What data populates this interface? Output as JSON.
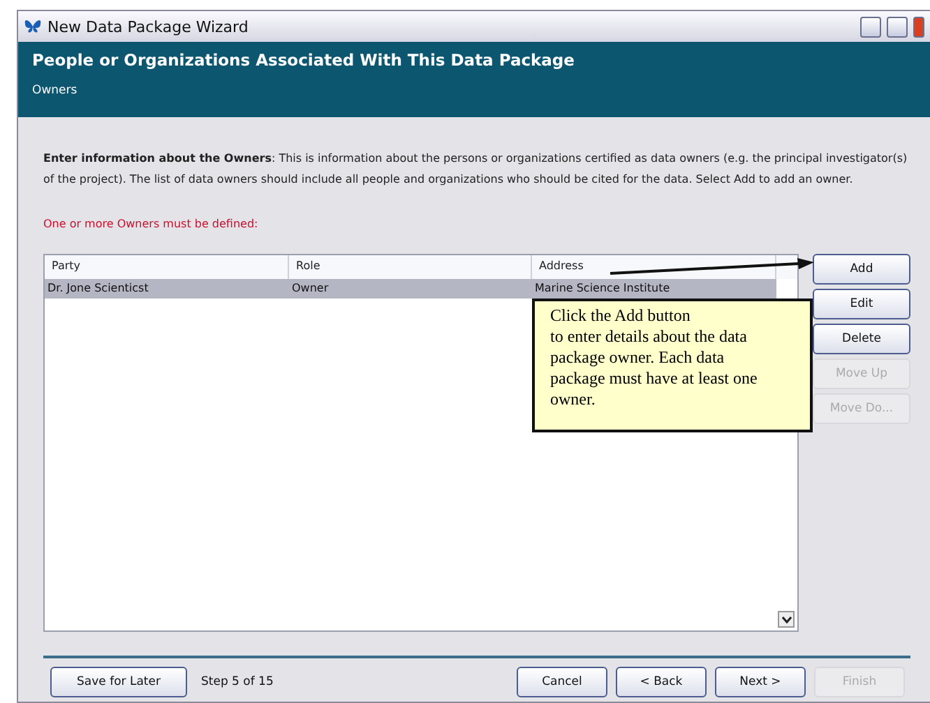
{
  "window": {
    "title": "New Data Package Wizard"
  },
  "header": {
    "title": "People or Organizations Associated With This Data Package",
    "subtitle": "Owners"
  },
  "intro": "**Enter information about the Owners**: This is information about the persons or organizations certified as data owners (e.g. the principal investigator(s) of the project). The list of data owners should include all people and organizations who should be cited for the data. Select Add to add an owner.",
  "error": "One or more Owners must be defined:",
  "table": {
    "columns": [
      "Party",
      "Role",
      "Address"
    ],
    "rows": [
      {
        "cells": [
          "Dr. Jone Scienticst",
          "Owner",
          "Marine Science Institute"
        ],
        "selected": true
      }
    ]
  },
  "side_buttons": [
    {
      "label": "Add",
      "disabled": false
    },
    {
      "label": "Edit",
      "disabled": false
    },
    {
      "label": "Delete",
      "disabled": false
    },
    {
      "label": "Move Up",
      "disabled": true
    },
    {
      "label": "Move Do...",
      "disabled": true
    }
  ],
  "callout": "Click the Add button\nto enter details about the data package owner. Each data package must have at least one owner.",
  "footer": {
    "save": "Save for Later",
    "step": "Step 5 of 15",
    "buttons": [
      {
        "label": "Cancel",
        "disabled": false
      },
      {
        "label": "< Back",
        "disabled": false
      },
      {
        "label": "Next >",
        "disabled": false
      },
      {
        "label": "Finish",
        "disabled": true
      }
    ]
  }
}
